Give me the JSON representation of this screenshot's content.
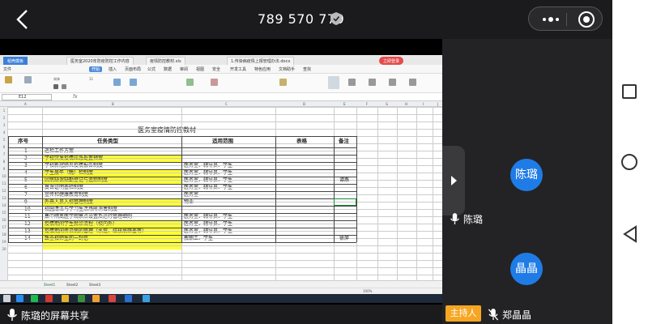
{
  "header": {
    "meeting_id": "789 570 779"
  },
  "shared_screen": {
    "browser_tabs": [
      "稻壳模板",
      "医务室2020年防疫防控工作内容",
      "疫情防控教材.xls",
      "1.传染病疫情上报管理办法.docx",
      "立即登录"
    ],
    "menu": [
      "文件",
      "开始",
      "插入",
      "页面布局",
      "公式",
      "数据",
      "审阅",
      "视图",
      "安全",
      "开发工具",
      "特色应用",
      "文档助手",
      "查找"
    ],
    "active_menu": "开始",
    "font_name": "宋体",
    "font_size": "11",
    "name_box": "E12",
    "fx": "fx",
    "columns": [
      "A",
      "B",
      "C",
      "D",
      "E",
      "F",
      "G",
      "H",
      "I",
      "J"
    ],
    "sheet_title": "医务室疫情防控教材",
    "table_headers": [
      "序号",
      "任务类型",
      "适用范围",
      "表格",
      "备注"
    ],
    "rows": [
      {
        "num": "1",
        "task": "巡检工作方案",
        "scope": "",
        "note": ""
      },
      {
        "num": "2",
        "task": "学校突发疫情应急处置预案",
        "scope": "",
        "note": ""
      },
      {
        "num": "3",
        "task": "学校新冠肺炎疫情报告制度",
        "scope": "医务室、辅导员、学生",
        "note": ""
      },
      {
        "num": "4",
        "task": "学生晨午（晚）检制度",
        "scope": "医务室、辅导员、学生",
        "note": "谭燕"
      },
      {
        "num": "5",
        "task": "因病缺课缺勤登记与追踪制度",
        "scope": "医务室、辅导员、学生",
        "note": ""
      },
      {
        "num": "6",
        "task": "复课证明查验制度",
        "scope": "医务室、辅导员、学生",
        "note": ""
      },
      {
        "num": "7",
        "task": "宣传和健康教育制度",
        "scope": "医务室",
        "note": ""
      },
      {
        "num": "9",
        "task": "外来人员入校管理制度",
        "scope": "物业",
        "note": ""
      },
      {
        "num": "10",
        "task": "校园清洁与学习生活场所消毒制度",
        "scope": "",
        "note": ""
      },
      {
        "num": "11",
        "task": "集中隔离医学观察点设置及运行管理细则",
        "scope": "医务室、辅导员、学生",
        "note": ""
      },
      {
        "num": "12",
        "task": "疫情期间学生就诊流程（校内外）",
        "scope": "医务室、辅导员、学生",
        "note": "徐萍"
      },
      {
        "num": "13",
        "task": "疫情期间传染病的管理（水痘、结核病筛查等）",
        "scope": "医务室、辅导员、学生",
        "note": ""
      },
      {
        "num": "14",
        "task": "致全校师生的一封信",
        "scope": "教职工、学生",
        "note": ""
      }
    ],
    "sheets": [
      "Sheet1",
      "Sheet2",
      "Sheet3"
    ],
    "zoom": "100%"
  },
  "share_caption": "陈璐的屏幕共享",
  "participants": {
    "presenter_avatar": "陈璐",
    "presenter_name": "陈璐",
    "host_badge": "主持人",
    "second_avatar": "晶晶",
    "second_name": "郑晶晶"
  },
  "colors": {
    "accent": "#1f7ce6",
    "highlight": "#ffff33",
    "host": "#f6a623"
  }
}
